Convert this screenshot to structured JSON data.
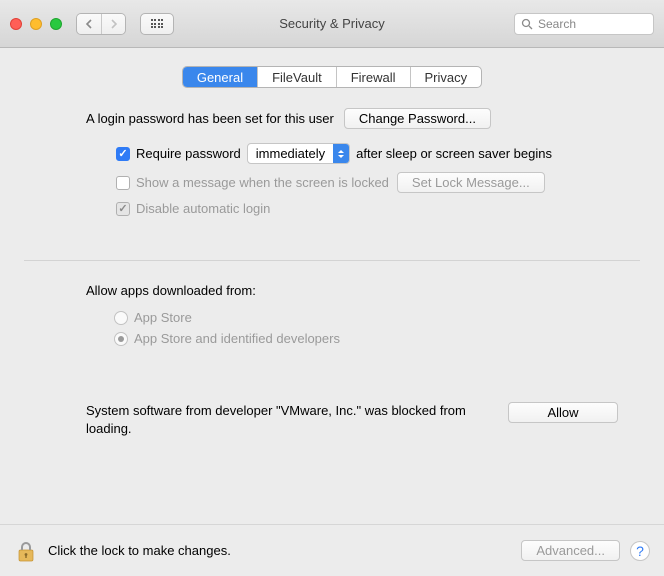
{
  "window": {
    "title": "Security & Privacy"
  },
  "search": {
    "placeholder": "Search"
  },
  "tabs": {
    "general": "General",
    "filevault": "FileVault",
    "firewall": "Firewall",
    "privacy": "Privacy"
  },
  "login": {
    "password_set_text": "A login password has been set for this user",
    "change_password_btn": "Change Password...",
    "require_password_label": "Require password",
    "require_password_delay": "immediately",
    "require_password_after": "after sleep or screen saver begins",
    "show_message_label": "Show a message when the screen is locked",
    "set_lock_message_btn": "Set Lock Message...",
    "disable_auto_login_label": "Disable automatic login"
  },
  "allow": {
    "heading": "Allow apps downloaded from:",
    "app_store": "App Store",
    "app_store_dev": "App Store and identified developers"
  },
  "blocked": {
    "message": "System software from developer \"VMware, Inc.\" was blocked from loading.",
    "allow_btn": "Allow"
  },
  "footer": {
    "lock_text": "Click the lock to make changes.",
    "advanced_btn": "Advanced..."
  }
}
